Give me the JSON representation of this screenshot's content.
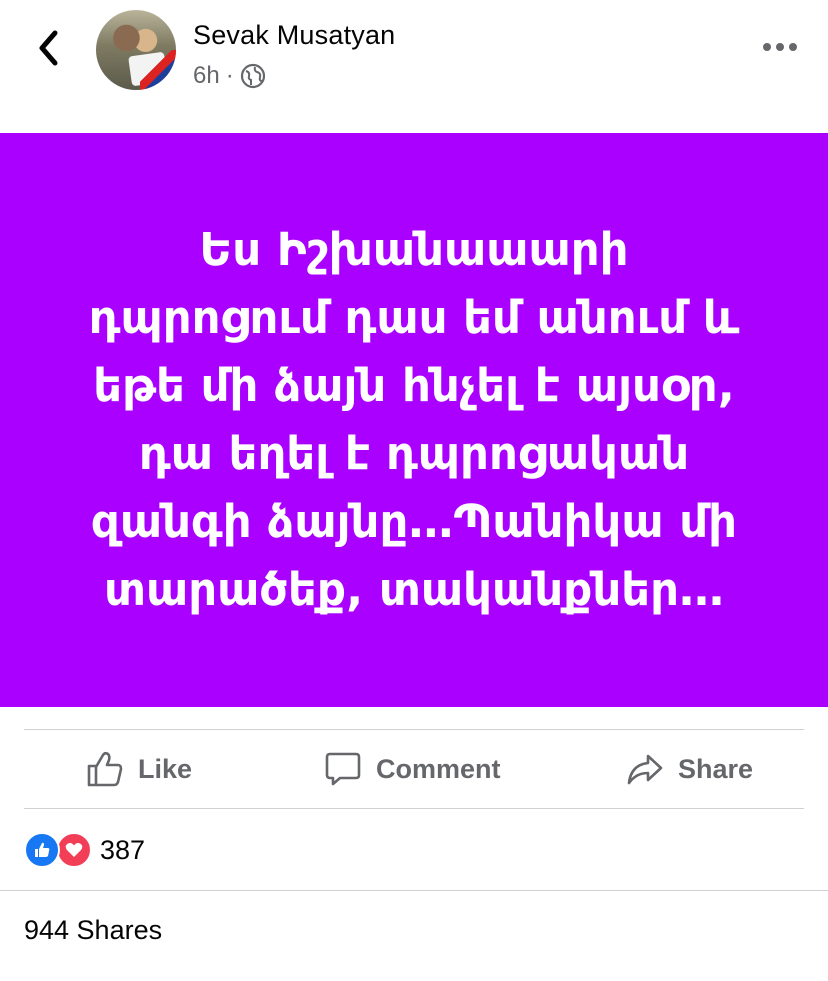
{
  "header": {
    "author_name": "Sevak Musatyan",
    "time": "6h",
    "separator": "·",
    "privacy_icon": "globe-icon",
    "back_icon": "chevron-left-icon",
    "more_icon": "more-horizontal-icon"
  },
  "post": {
    "background_color": "#a900ff",
    "text_lines": [
      "Ես Իշխանաաարի",
      "դպրոցում դաս եմ անում և",
      "եթե մի ձայն հնչել է այսօր,",
      "դա եղել է դպրոցական",
      "զանգի ձայնը…Պանիկա մի",
      "տարածեք, տականքներ…"
    ]
  },
  "actions": {
    "like": {
      "label": "Like",
      "icon": "thumbs-up-icon"
    },
    "comment": {
      "label": "Comment",
      "icon": "comment-icon"
    },
    "share": {
      "label": "Share",
      "icon": "share-arrow-icon"
    }
  },
  "reactions": {
    "count": "387",
    "icons": [
      "like-reaction-icon",
      "love-reaction-icon"
    ]
  },
  "shares_text": "944 Shares"
}
